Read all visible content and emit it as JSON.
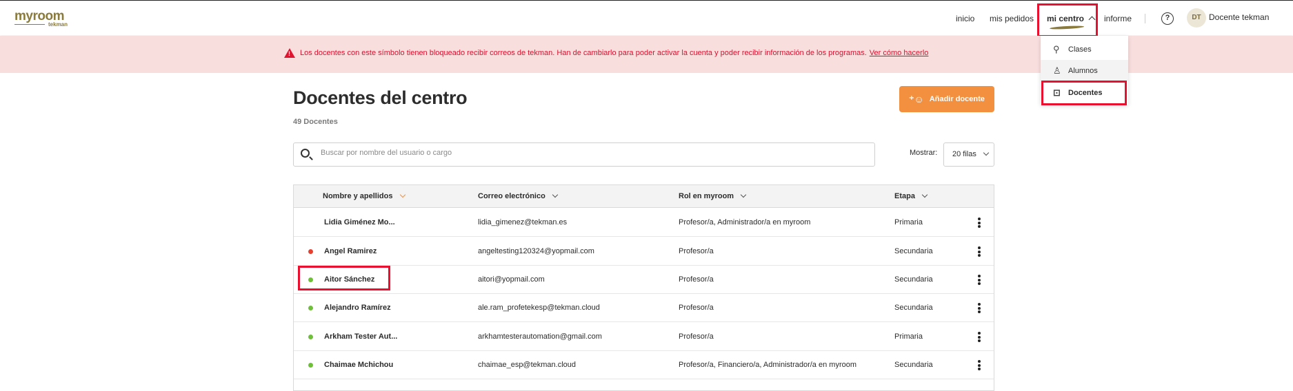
{
  "header": {
    "logo_main": "myroom",
    "logo_sub": "tekman",
    "nav": {
      "inicio": "inicio",
      "mis_pedidos": "mis pedidos",
      "mi_centro": "mi centro",
      "informe": "informe"
    },
    "help": "?",
    "avatar_initials": "DT",
    "user_name": "Docente tekman"
  },
  "banner": {
    "message": "Los docentes con este símbolo tienen bloqueado recibir correos de tekman. Han de cambiarlo para poder activar la cuenta y poder recibir información de los programas.",
    "link": "Ver cómo hacerlo",
    "color": "#d8112e"
  },
  "dropdown": {
    "items": [
      {
        "label": "Clases",
        "icon": "classes-icon"
      },
      {
        "label": "Alumnos",
        "icon": "students-icon"
      },
      {
        "label": "Docentes",
        "icon": "teachers-icon"
      }
    ]
  },
  "page": {
    "title": "Docentes del centro",
    "count": "49 Docentes",
    "add_button": "Añadir docente",
    "accent": "#f29040"
  },
  "search": {
    "placeholder": "Buscar por nombre del usuario o cargo"
  },
  "pagination": {
    "label": "Mostrar:",
    "value": "20 filas"
  },
  "table": {
    "headers": [
      "Nombre y apellidos",
      "Correo electrónico",
      "Rol en myroom",
      "Etapa"
    ],
    "rows": [
      {
        "status": "none",
        "name": "Lidia Giménez Mo...",
        "email": "lidia_gimenez@tekman.es",
        "role": "Profesor/a, Administrador/a en myroom",
        "stage": "Primaria"
      },
      {
        "status": "red",
        "name": "Angel Ramirez",
        "email": "angeltesting120324@yopmail.com",
        "role": "Profesor/a",
        "stage": "Secundaria"
      },
      {
        "status": "green",
        "name": "Aitor Sánchez",
        "email": "aitori@yopmail.com",
        "role": "Profesor/a",
        "stage": "Secundaria"
      },
      {
        "status": "green",
        "name": "Alejandro Ramírez",
        "email": "ale.ram_profetekesp@tekman.cloud",
        "role": "Profesor/a",
        "stage": "Secundaria"
      },
      {
        "status": "green",
        "name": "Arkham Tester Aut...",
        "email": "arkhamtesterautomation@gmail.com",
        "role": "Profesor/a",
        "stage": "Primaria"
      },
      {
        "status": "green",
        "name": "Chaimae Mchichou",
        "email": "chaimae_esp@tekman.cloud",
        "role": "Profesor/a, Financiero/a, Administrador/a en myroom",
        "stage": "Secundaria"
      }
    ],
    "status_colors": {
      "red": "#e8402e",
      "green": "#6fbf3a"
    }
  }
}
